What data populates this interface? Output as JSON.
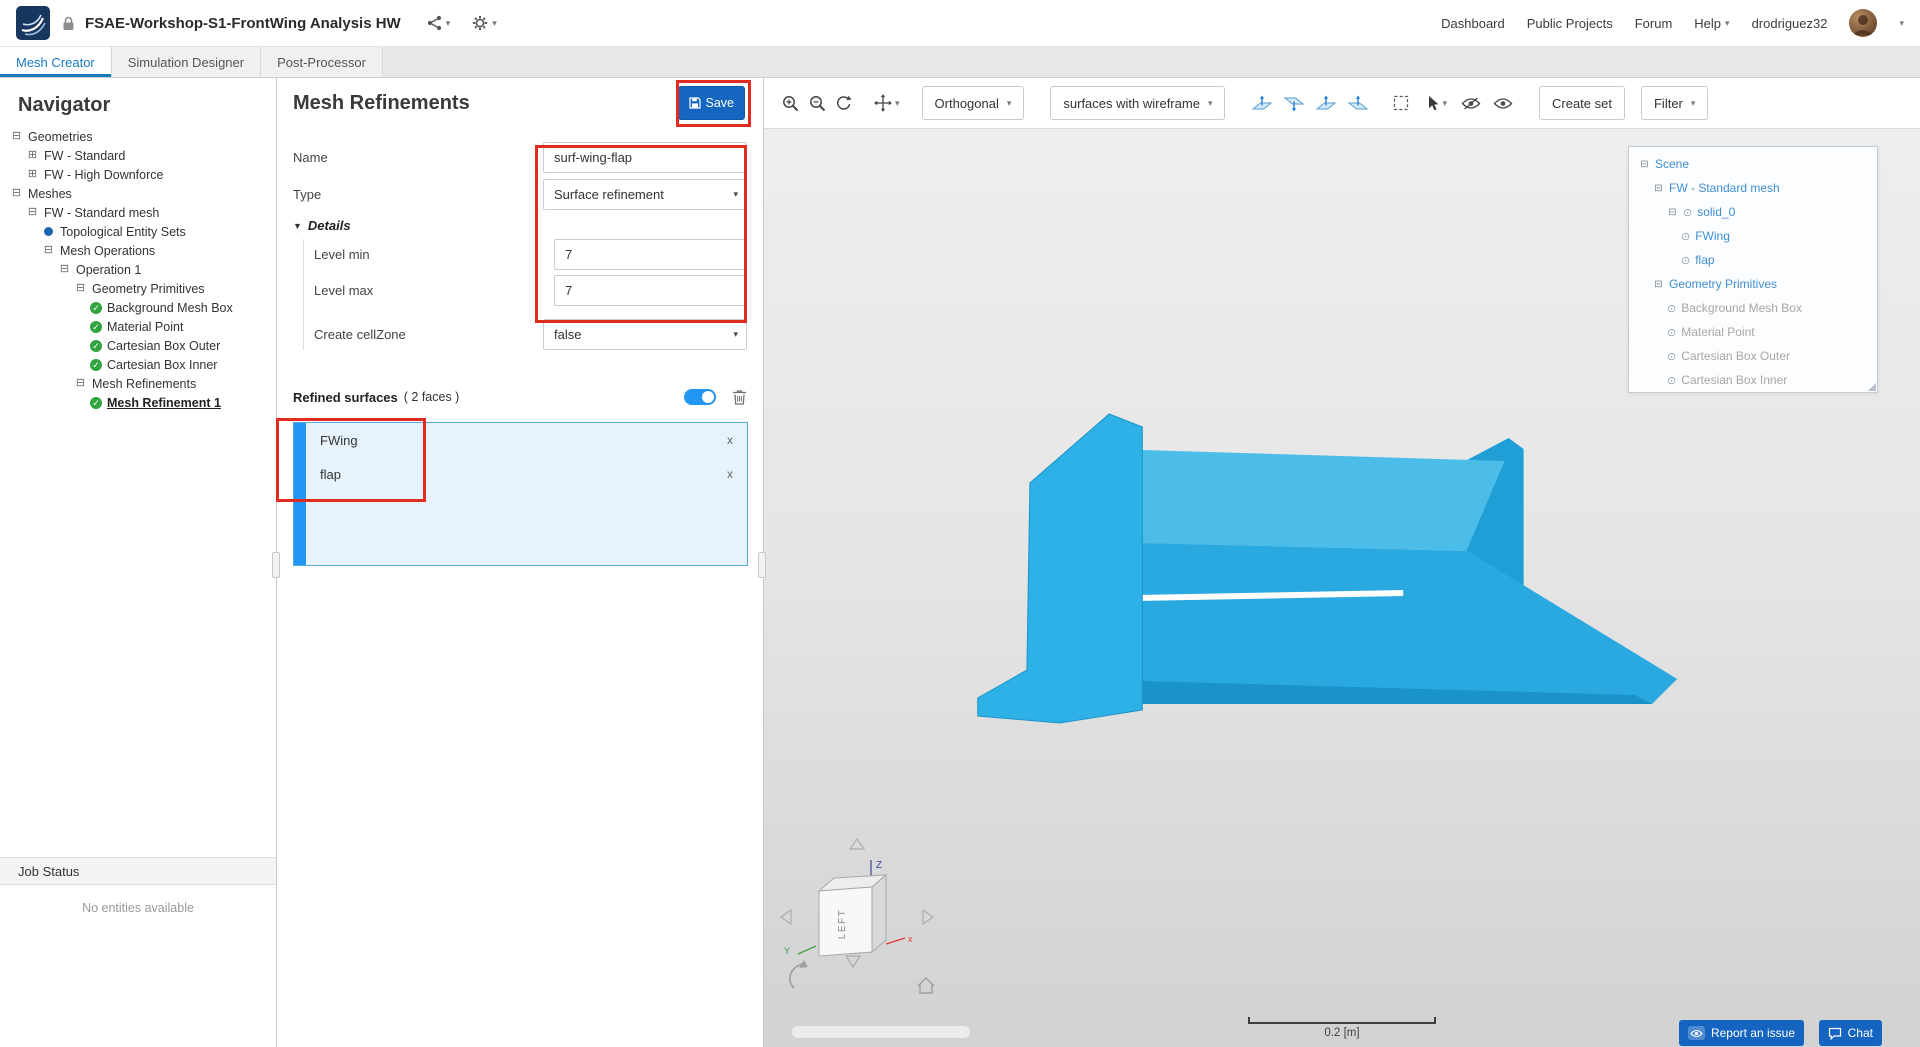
{
  "icons": {
    "expander_open": "⊟",
    "expander_closed": "⊞",
    "chevron": "▾",
    "select_arrow": "▾",
    "details_arrow": "▼",
    "eye_dot": "⊙",
    "close": "x",
    "check": "✓"
  },
  "colors": {
    "accent_blue": "#1976d2",
    "model_blue": "#29a9e0",
    "selection_bg": "#e7f3fc",
    "annotation_red": "#e02b20"
  },
  "topbar": {
    "title": "FSAE-Workshop-S1-FrontWing Analysis HW",
    "links": [
      "Dashboard",
      "Public Projects",
      "Forum",
      "Help"
    ],
    "username": "drodriguez32"
  },
  "tabs": {
    "mesh_creator": "Mesh Creator",
    "simulation_designer": "Simulation Designer",
    "post_processor": "Post-Processor"
  },
  "navigator": {
    "title": "Navigator",
    "tree": [
      {
        "label": "Geometries"
      },
      {
        "label": "FW - Standard"
      },
      {
        "label": "FW - High Downforce"
      },
      {
        "label": "Meshes"
      },
      {
        "label": "FW - Standard mesh"
      },
      {
        "label": "Topological Entity Sets"
      },
      {
        "label": "Mesh Operations"
      },
      {
        "label": "Operation 1"
      },
      {
        "label": "Geometry Primitives"
      },
      {
        "label": "Background Mesh Box"
      },
      {
        "label": "Material Point"
      },
      {
        "label": "Cartesian Box Outer"
      },
      {
        "label": "Cartesian Box Inner"
      },
      {
        "label": "Mesh Refinements"
      },
      {
        "label": "Mesh Refinement 1"
      }
    ],
    "job_status_title": "Job Status",
    "job_status_empty": "No entities available"
  },
  "editor": {
    "title": "Mesh Refinements",
    "save_label": "Save",
    "name_label": "Name",
    "name_value": "surf-wing-flap",
    "type_label": "Type",
    "type_value": "Surface refinement",
    "details_label": "Details",
    "level_min_label": "Level min",
    "level_min_value": "7",
    "level_max_label": "Level max",
    "level_max_value": "7",
    "cellzone_label": "Create cellZone",
    "cellzone_value": "false",
    "refined_label": "Refined surfaces",
    "refined_count": "( 2 faces )",
    "surfaces": [
      {
        "name": "FWing"
      },
      {
        "name": "flap"
      }
    ]
  },
  "viewport": {
    "projection": "Orthogonal",
    "render_mode": "surfaces with wireframe",
    "create_set": "Create set",
    "filter": "Filter",
    "scene_tree": [
      {
        "label": "Scene"
      },
      {
        "label": "FW - Standard mesh"
      },
      {
        "label": "solid_0"
      },
      {
        "label": "FWing"
      },
      {
        "label": "flap"
      },
      {
        "label": "Geometry Primitives"
      },
      {
        "label": "Background Mesh Box"
      },
      {
        "label": "Material Point"
      },
      {
        "label": "Cartesian Box Outer"
      },
      {
        "label": "Cartesian Box Inner"
      }
    ],
    "cube_face": "LEFT",
    "axis_z": "Z",
    "axis_x": "x",
    "axis_y": "Y",
    "scale_label": "0.2 [m]",
    "report_issue": "Report an issue",
    "chat": "Chat"
  }
}
